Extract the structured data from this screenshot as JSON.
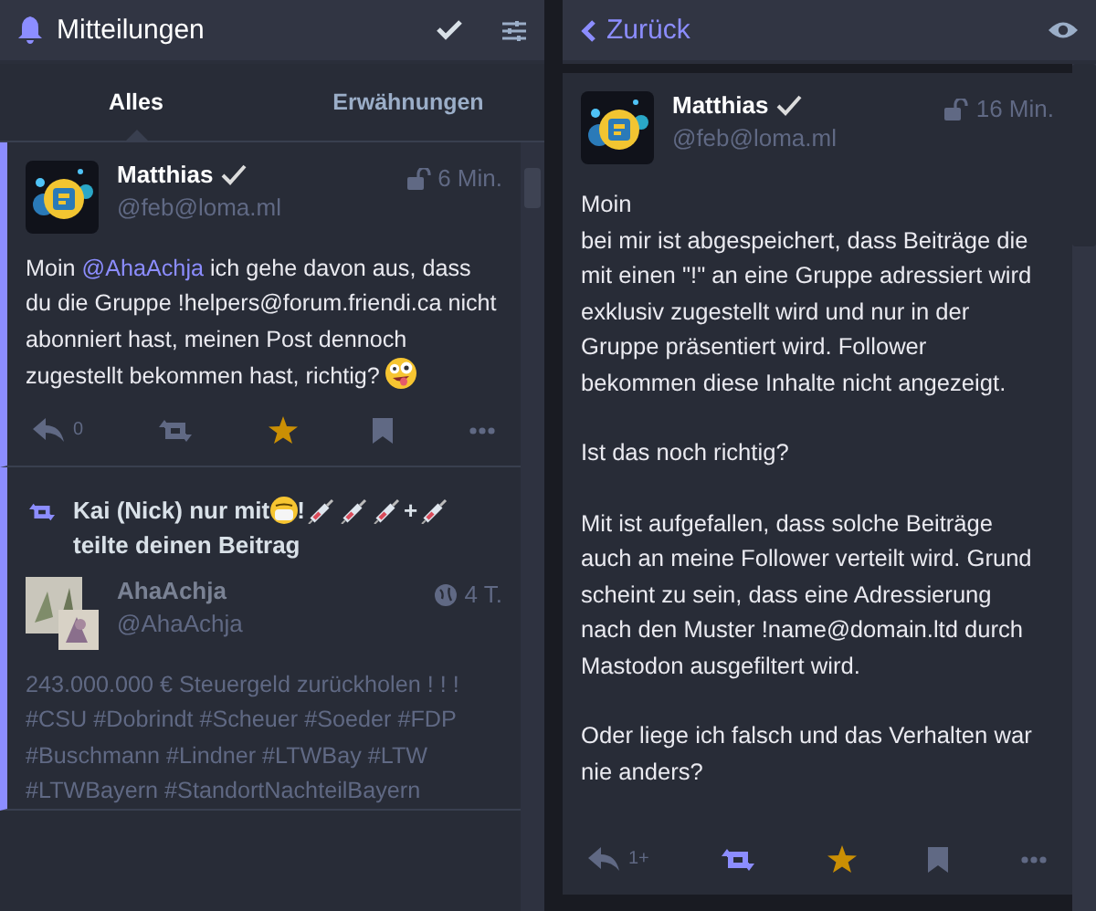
{
  "left": {
    "header": {
      "title": "Mitteilungen"
    },
    "tabs": [
      {
        "label": "Alles",
        "selected": true
      },
      {
        "label": "Erwähnungen",
        "selected": false
      }
    ],
    "notifications": [
      {
        "kind": "status",
        "unread": true,
        "author": {
          "name": "Matthias",
          "handle": "@feb@loma.ml",
          "verified": true
        },
        "public": false,
        "time": "6 Min.",
        "dim": false,
        "body": [
          [
            {
              "kind": "text",
              "text": "Moin "
            },
            {
              "kind": "mention",
              "text": "@AhaAchja"
            },
            {
              "kind": "text",
              "text": " ich gehe davon aus, dass du die Gruppe !helpers@forum.friendi.ca nicht abonniert hast, meinen Post dennoch zugestellt bekommen hast, richtig? "
            },
            {
              "kind": "emoji-crazy"
            }
          ]
        ],
        "actions": {
          "reply_count": "0",
          "boosted": false,
          "favourited": true
        }
      },
      {
        "kind": "reblog",
        "unread": true,
        "booster": [
          {
            "kind": "text",
            "text": "Kai (Nick) nur mit"
          },
          {
            "kind": "emoji-mask"
          },
          {
            "kind": "text",
            "text": "!"
          },
          {
            "kind": "emoji-syringe"
          },
          {
            "kind": "emoji-syringe"
          },
          {
            "kind": "emoji-syringe"
          },
          {
            "kind": "text",
            "text": "+"
          },
          {
            "kind": "emoji-syringe"
          }
        ],
        "action_text": "teilte deinen Beitrag",
        "author": {
          "name": "AhaAchja",
          "handle": "@AhaAchja",
          "verified": false
        },
        "public": true,
        "time": "4 T.",
        "dim": true,
        "body": [
          [
            {
              "kind": "text",
              "text": "243.000.000 € Steuergeld zurückholen ! ! ! #CSU #Dobrindt #Scheuer #Soeder #FDP #Buschmann #Lindner #LTWBay #LTW #LTWBayern #StandortNachteilBayern"
            }
          ]
        ]
      }
    ]
  },
  "right": {
    "header": {
      "back": "Zurück"
    },
    "status": {
      "author": {
        "name": "Matthias",
        "handle": "@feb@loma.ml",
        "verified": true
      },
      "public": false,
      "time": "16 Min.",
      "paragraphs": [
        "Moin\nbei mir ist abgespeichert, dass Beiträge die mit einen \"!\" an eine Gruppe adressiert wird exklusiv zugestellt wird und nur in der Gruppe präsentiert wird. Follower bekommen diese Inhalte nicht angezeigt.",
        "Ist das noch richtig?",
        "Mit ist aufgefallen, dass solche Beiträge auch an meine Follower verteilt wird. Grund scheint zu sein, dass eine Adressierung nach den Muster !name@domain.ltd durch Mastodon ausgefiltert wird.",
        "Oder liege ich falsch und das Verhalten war nie anders?"
      ],
      "actions": {
        "reply_count": "1+",
        "boosted": true,
        "favourited": true
      }
    }
  }
}
